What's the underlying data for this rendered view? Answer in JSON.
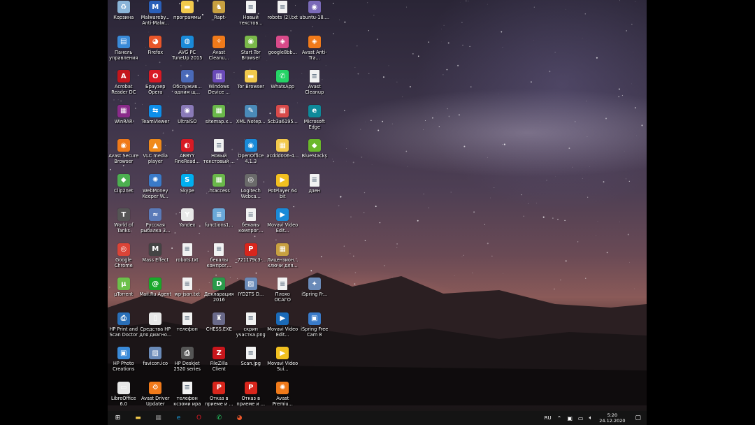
{
  "desktop": {
    "icons": [
      {
        "label": "Корзина",
        "icon": "recycle-bin-icon",
        "color": "#8ab4d8",
        "glyph": "♻"
      },
      {
        "label": "Панель управления",
        "icon": "control-panel-icon",
        "color": "#3a8ad8",
        "glyph": "▤"
      },
      {
        "label": "Acrobat Reader DC",
        "icon": "acrobat-icon",
        "color": "#c4161c",
        "glyph": "A"
      },
      {
        "label": "WinRAR",
        "icon": "winrar-icon",
        "color": "#8a2a8a",
        "glyph": "▦"
      },
      {
        "label": "Avast Secure Browser",
        "icon": "avast-browser-icon",
        "color": "#f07a1a",
        "glyph": "◉"
      },
      {
        "label": "Clip2net",
        "icon": "clip2net-icon",
        "color": "#4caf50",
        "glyph": "◆"
      },
      {
        "label": "World of Tanks",
        "icon": "world-of-tanks-icon",
        "color": "#555555",
        "glyph": "T"
      },
      {
        "label": "Google Chrome",
        "icon": "chrome-icon",
        "color": "#db4437",
        "glyph": "◎"
      },
      {
        "label": "µTorrent",
        "icon": "utorrent-icon",
        "color": "#6cc04a",
        "glyph": "µ"
      },
      {
        "label": "HP Print and Scan Doctor",
        "icon": "hp-print-icon",
        "color": "#2a6fb8",
        "glyph": "⎙"
      },
      {
        "label": "HP Photo Creations",
        "icon": "hp-photo-icon",
        "color": "#3a8ad8",
        "glyph": "▣"
      },
      {
        "label": "LibreOffice 6.0",
        "icon": "libreoffice-icon",
        "color": "#e8e8e8",
        "glyph": "▭"
      },
      {
        "label": "Malwareby... Anti-Malw...",
        "icon": "malwarebytes-icon",
        "color": "#2a5fb8",
        "glyph": "M"
      },
      {
        "label": "Firefox",
        "icon": "firefox-icon",
        "color": "#e8562a",
        "glyph": "◕"
      },
      {
        "label": "Браузер Opera",
        "icon": "opera-icon",
        "color": "#d81a24",
        "glyph": "O"
      },
      {
        "label": "TeamViewer",
        "icon": "teamviewer-icon",
        "color": "#0e8ee9",
        "glyph": "⇆"
      },
      {
        "label": "VLC media player",
        "icon": "vlc-icon",
        "color": "#f08a1a",
        "glyph": "▲"
      },
      {
        "label": "WebMoney Keeper W...",
        "icon": "webmoney-icon",
        "color": "#3a7ac8",
        "glyph": "✺"
      },
      {
        "label": "Русская рыбалка 3...",
        "icon": "fishing-game-icon",
        "color": "#5a7ab8",
        "glyph": "≈"
      },
      {
        "label": "Mass Effect",
        "icon": "mass-effect-icon",
        "color": "#444444",
        "glyph": "M"
      },
      {
        "label": "Mail.Ru Agent",
        "icon": "mailru-agent-icon",
        "color": "#1aa82a",
        "glyph": "@"
      },
      {
        "label": "Средства HP для диагно...",
        "icon": "hp-diagnostics-icon",
        "color": "#e8e8e8",
        "glyph": "▯"
      },
      {
        "label": "favicon.ico",
        "icon": "image-file-icon",
        "color": "#6a8ab8",
        "glyph": "▨"
      },
      {
        "label": "Avast Driver Updater",
        "icon": "avast-driver-icon",
        "color": "#f07a1a",
        "glyph": "⚙"
      },
      {
        "label": "программы",
        "icon": "folder-icon",
        "color": "#f2c94c",
        "glyph": "▬"
      },
      {
        "label": "AVG PC TuneUp 2015",
        "icon": "avg-tuneup-icon",
        "color": "#1a8ad8",
        "glyph": "◍"
      },
      {
        "label": "Обслужив... одним щ...",
        "icon": "one-click-service-icon",
        "color": "#4a6ab8",
        "glyph": "✦"
      },
      {
        "label": "UltraISO",
        "icon": "ultraiso-icon",
        "color": "#8a7ab8",
        "glyph": "◉"
      },
      {
        "label": "ABBYY FineRead...",
        "icon": "abbyy-icon",
        "color": "#d81a24",
        "glyph": "◐"
      },
      {
        "label": "Skype",
        "icon": "skype-icon",
        "color": "#00aff0",
        "glyph": "S"
      },
      {
        "label": "Yandex",
        "icon": "yandex-icon",
        "color": "#e8e8e8",
        "glyph": "Y"
      },
      {
        "label": "robots.txt",
        "icon": "text-file-icon",
        "color": "#f2f2f2",
        "glyph": "≡"
      },
      {
        "label": "wp-json.txt",
        "icon": "text-file-icon",
        "color": "#f2f2f2",
        "glyph": "≡"
      },
      {
        "label": "телефон",
        "icon": "text-file-icon",
        "color": "#f2f2f2",
        "glyph": "≡"
      },
      {
        "label": "HP Deskjet 2520 series",
        "icon": "hp-deskjet-icon",
        "color": "#555555",
        "glyph": "⎙"
      },
      {
        "label": "телефон ксзоми ира",
        "icon": "text-file-icon",
        "color": "#f2f2f2",
        "glyph": "≡"
      },
      {
        "label": "_Rapt-",
        "icon": "raptor-icon",
        "color": "#c8a040",
        "glyph": "♞"
      },
      {
        "label": "Avast Cleanu...",
        "icon": "avast-cleanup-icon",
        "color": "#f07a1a",
        "glyph": "✧"
      },
      {
        "label": "Windows Device ...",
        "icon": "windows-device-icon",
        "color": "#6a4ab8",
        "glyph": "▥"
      },
      {
        "label": "sitemap.x...",
        "icon": "sitemap-file-icon",
        "color": "#6ab84a",
        "glyph": "▦"
      },
      {
        "label": "Новый текстовый ...",
        "icon": "text-file-icon",
        "color": "#f2f2f2",
        "glyph": "≡"
      },
      {
        "label": ".htaccess",
        "icon": "htaccess-file-icon",
        "color": "#6ab84a",
        "glyph": "▦"
      },
      {
        "label": "functions1...",
        "icon": "php-file-icon",
        "color": "#6aa8d8",
        "glyph": "≡"
      },
      {
        "label": "бекалы компрог...",
        "icon": "text-file-icon",
        "color": "#f2f2f2",
        "glyph": "≡"
      },
      {
        "label": "Декларация 2016",
        "icon": "declaration-icon",
        "color": "#2a9a4a",
        "glyph": "D"
      },
      {
        "label": "CHESS.EXE",
        "icon": "chess-icon",
        "color": "#6a6a8a",
        "glyph": "♜"
      },
      {
        "label": "FileZilla Client",
        "icon": "filezilla-icon",
        "color": "#c8161c",
        "glyph": "Z"
      },
      {
        "label": "Отказ в приеме и ...",
        "icon": "pdf-file-icon",
        "color": "#d8261c",
        "glyph": "P"
      },
      {
        "label": "Новый текстов...",
        "icon": "text-file-icon",
        "color": "#f2f2f2",
        "glyph": "≡"
      },
      {
        "label": "Start Tor Browser",
        "icon": "tor-browser-icon",
        "color": "#7ab84a",
        "glyph": "◉"
      },
      {
        "label": "Tor Browser",
        "icon": "tor-folder-icon",
        "color": "#f2c94c",
        "glyph": "▬"
      },
      {
        "label": "XML Notep...",
        "icon": "xml-notepad-icon",
        "color": "#4a8ab8",
        "glyph": "✎"
      },
      {
        "label": "OpenOffice 4.1.3",
        "icon": "openoffice-icon",
        "color": "#1a8ad8",
        "glyph": "◉"
      },
      {
        "label": "Logitech Webca...",
        "icon": "logitech-icon",
        "color": "#6a6a6a",
        "glyph": "◎"
      },
      {
        "label": "бекалы компрог...",
        "icon": "text-file-icon",
        "color": "#f2f2f2",
        "glyph": "≡"
      },
      {
        "label": "_721179c3-...",
        "icon": "pdf-file-icon",
        "color": "#d8261c",
        "glyph": "P"
      },
      {
        "label": "IYD2TS D...",
        "icon": "image-file-icon",
        "color": "#6a8ab8",
        "glyph": "▨"
      },
      {
        "label": "скрин участка.png",
        "icon": "text-file-icon",
        "color": "#f2f2f2",
        "glyph": "≡"
      },
      {
        "label": "Scan.jpg",
        "icon": "text-file-icon",
        "color": "#f2f2f2",
        "glyph": "≡"
      },
      {
        "label": "Отказ в приеме и ...",
        "icon": "pdf-file-icon",
        "color": "#d8261c",
        "glyph": "P"
      },
      {
        "label": "robots (2).txt",
        "icon": "text-file-icon",
        "color": "#f2f2f2",
        "glyph": "≡"
      },
      {
        "label": "google8bb...",
        "icon": "google-file-icon",
        "color": "#d84a8a",
        "glyph": "◈"
      },
      {
        "label": "WhatsApp",
        "icon": "whatsapp-icon",
        "color": "#25d366",
        "glyph": "✆"
      },
      {
        "label": "5cb3a6195...",
        "icon": "file-icon",
        "color": "#d84a4a",
        "glyph": "▦"
      },
      {
        "label": "acddd006-4...",
        "icon": "file-icon",
        "color": "#f2c94c",
        "glyph": "▦"
      },
      {
        "label": "PotPlayer 64 bit",
        "icon": "potplayer-icon",
        "color": "#f2c020",
        "glyph": "▶"
      },
      {
        "label": "Movavi Video Edit...",
        "icon": "movavi-icon",
        "color": "#1a8ad8",
        "glyph": "▶"
      },
      {
        "label": "Лицензион... ключи для...",
        "icon": "license-keys-icon",
        "color": "#c8a040",
        "glyph": "▦"
      },
      {
        "label": "Плохо ОСАГО",
        "icon": "text-file-icon",
        "color": "#f2f2f2",
        "glyph": "≡"
      },
      {
        "label": "Movavi Video Edit...",
        "icon": "movavi-icon",
        "color": "#1a6ab8",
        "glyph": "▶"
      },
      {
        "label": "Movavi Video Sui...",
        "icon": "movavi-suite-icon",
        "color": "#f2c020",
        "glyph": "▶"
      },
      {
        "label": "Avast Premiu...",
        "icon": "avast-premium-icon",
        "color": "#f07a1a",
        "glyph": "✺"
      },
      {
        "label": "ubuntu-18....",
        "icon": "disc-image-icon",
        "color": "#7a6ab8",
        "glyph": "◉"
      },
      {
        "label": "Avast Anti-Tra...",
        "icon": "avast-antitrack-icon",
        "color": "#f07a1a",
        "glyph": "◈"
      },
      {
        "label": "Avast Cleanup",
        "icon": "text-file-icon",
        "color": "#f2f2f2",
        "glyph": "≡"
      },
      {
        "label": "Microsoft Edge",
        "icon": "edge-icon",
        "color": "#0e8a9a",
        "glyph": "e"
      },
      {
        "label": "BlueStacks",
        "icon": "bluestacks-icon",
        "color": "#6ab82a",
        "glyph": "◆"
      },
      {
        "label": "дзен",
        "icon": "text-file-icon",
        "color": "#f2f2f2",
        "glyph": "≡"
      },
      {
        "label": "",
        "icon": "empty-slot-icon",
        "color": "",
        "glyph": ""
      },
      {
        "label": "",
        "icon": "empty-slot-icon",
        "color": "",
        "glyph": ""
      },
      {
        "label": "iSpring Fr...",
        "icon": "ispring-icon",
        "color": "#6a8ab8",
        "glyph": "✦"
      },
      {
        "label": "iSpring Free Cam 8",
        "icon": "ispring-cam-icon",
        "color": "#3a7ac8",
        "glyph": "▣"
      },
      {
        "label": "",
        "icon": "empty-slot-icon",
        "color": "",
        "glyph": ""
      },
      {
        "label": "",
        "icon": "empty-slot-icon",
        "color": "",
        "glyph": ""
      }
    ]
  },
  "taskbar": {
    "apps": [
      {
        "name": "start-button",
        "icon": "windows-start-icon",
        "color": "#ffffff",
        "glyph": "⊞"
      },
      {
        "name": "taskbar-explorer",
        "icon": "file-explorer-icon",
        "color": "#f2c94c",
        "glyph": "▬"
      },
      {
        "name": "taskbar-calculator",
        "icon": "calculator-icon",
        "color": "#8a8a8a",
        "glyph": "▦"
      },
      {
        "name": "taskbar-edge",
        "icon": "edge-icon",
        "color": "#1a9ad8",
        "glyph": "e"
      },
      {
        "name": "taskbar-opera",
        "icon": "opera-icon",
        "color": "#d81a24",
        "glyph": "O"
      },
      {
        "name": "taskbar-whatsapp",
        "icon": "whatsapp-icon",
        "color": "#25d366",
        "glyph": "✆"
      },
      {
        "name": "taskbar-firefox",
        "icon": "firefox-icon",
        "color": "#e8562a",
        "glyph": "◕"
      }
    ],
    "language": "RU",
    "time": "5:20",
    "date": "24.12.2020"
  }
}
